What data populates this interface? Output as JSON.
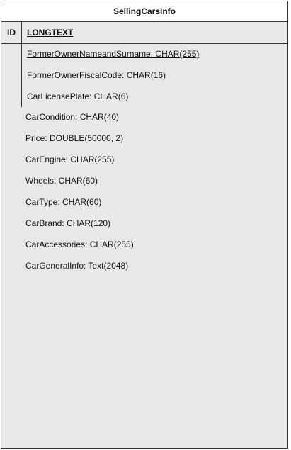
{
  "entity": {
    "title": "SellingCarsInfo",
    "primary_key": {
      "key_label": "ID",
      "name": "LONGTEXT"
    },
    "foreign_attributes": [
      {
        "underlined": "FormerOwnerNameandSurname: CHAR(255)",
        "rest": ""
      },
      {
        "underlined": "FormerOwner",
        "rest": "FiscalCode: CHAR(16)"
      },
      {
        "underlined": "",
        "rest": "CarLicensePlate: CHAR(6)"
      }
    ],
    "attributes": [
      "CarCondition: CHAR(40)",
      "Price: DOUBLE(50000, 2)",
      "CarEngine: CHAR(255)",
      "Wheels: CHAR(60)",
      "CarType: CHAR(60)",
      "CarBrand: CHAR(120)",
      "CarAccessories: CHAR(255)",
      "CarGeneralInfo: Text(2048)"
    ]
  }
}
